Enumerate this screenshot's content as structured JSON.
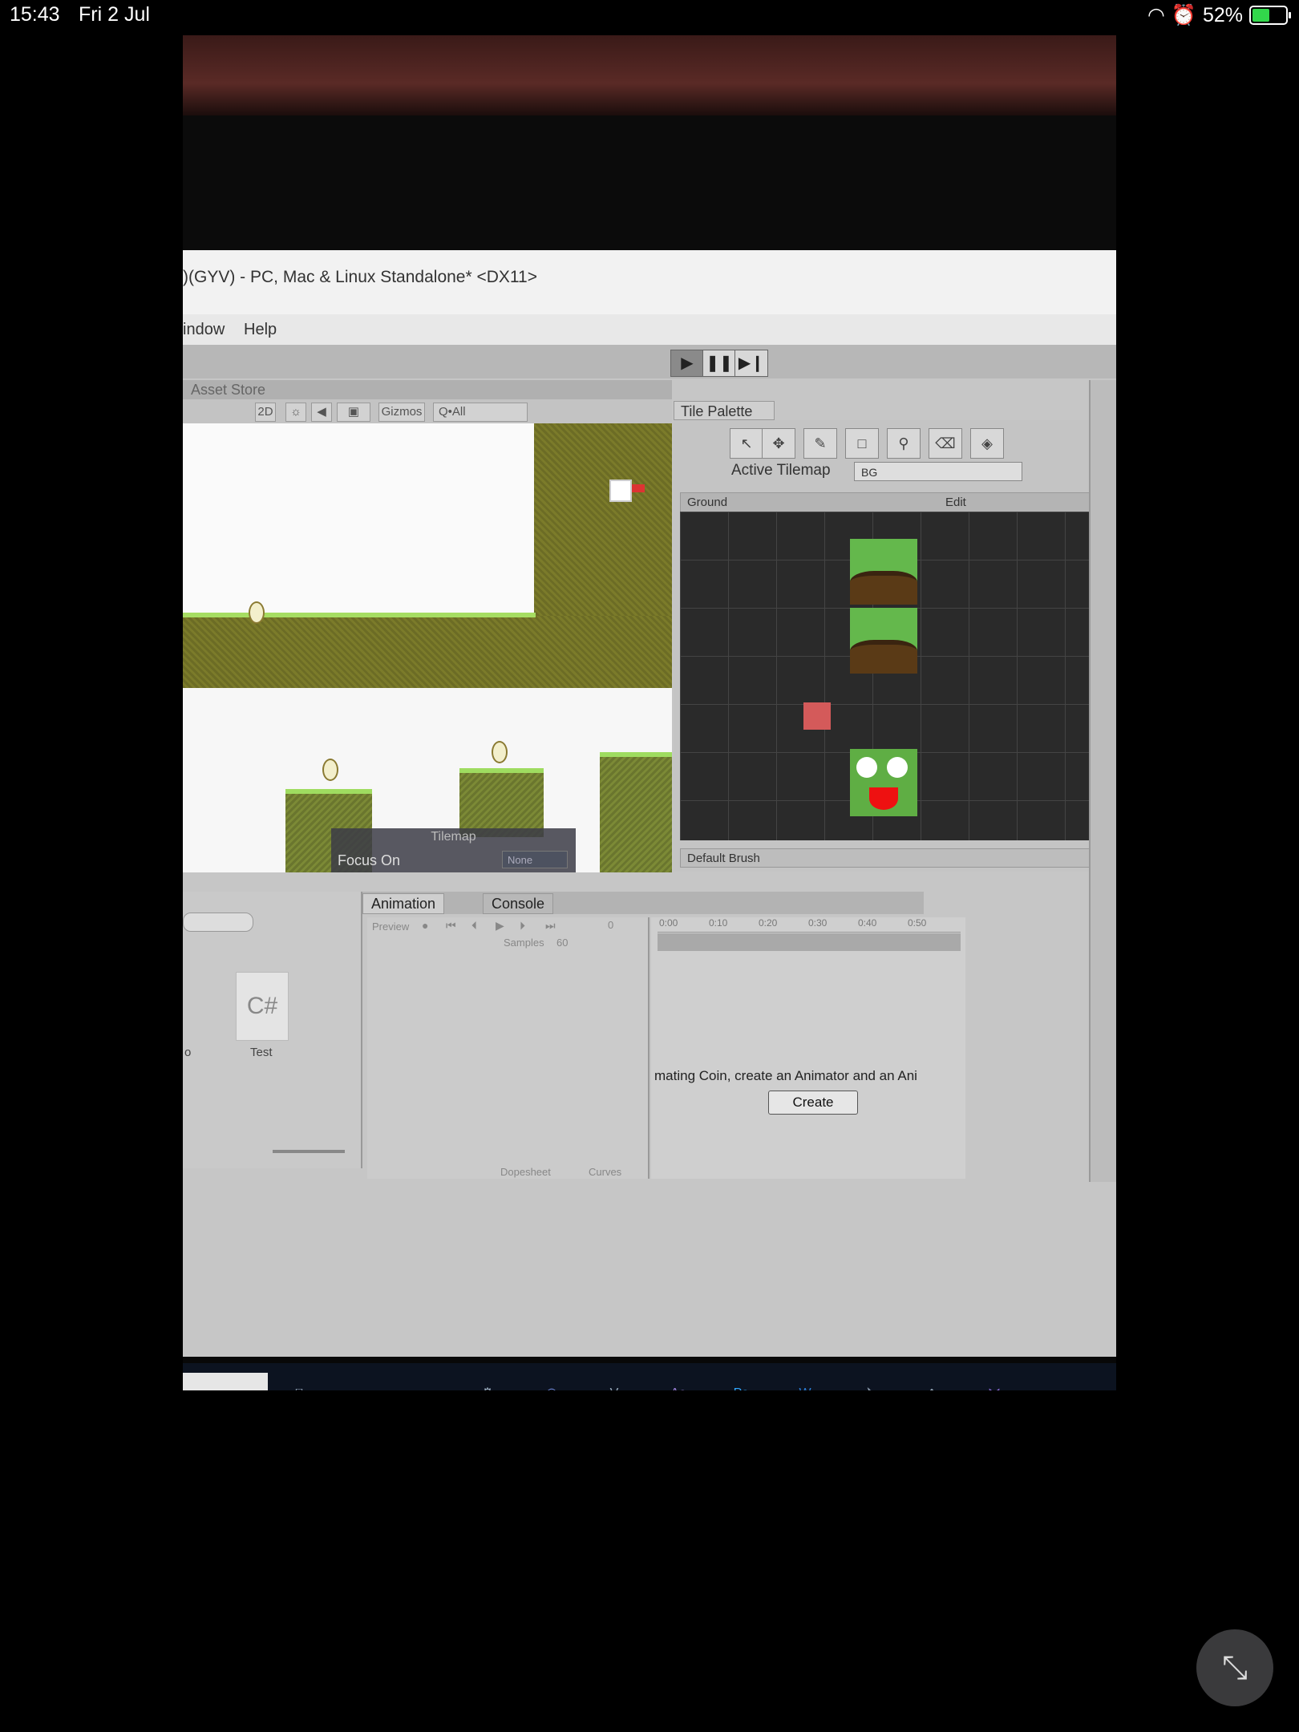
{
  "status": {
    "time": "15:43",
    "date": "Fri 2 Jul",
    "battery_percent": "52%",
    "battery_level": 0.52
  },
  "unity": {
    "title": ")(GYV) - PC, Mac & Linux Standalone* <DX11>",
    "menu": [
      "indow",
      "Help"
    ],
    "play_controls": [
      "play-icon",
      "pause-icon",
      "step-icon"
    ],
    "scene": {
      "asset_store_tab": "Asset Store",
      "mode_2d": "2D",
      "gizmos": "Gizmos",
      "search_placeholder": "Q•All",
      "tilemap_overlay": {
        "title": "Tilemap",
        "focus_label": "Focus On",
        "focus_value": "None"
      }
    },
    "tile_palette": {
      "tab": "Tile Palette",
      "tools": [
        "select-icon",
        "move-icon",
        "paint-brush-icon",
        "box-fill-icon",
        "picker-icon",
        "eraser-icon",
        "fill-icon"
      ],
      "active_tilemap_label": "Active Tilemap",
      "active_tilemap_value": "BG",
      "palette_name": "Ground",
      "edit_label": "Edit",
      "brush": "Default Brush"
    },
    "project": {
      "asset_icon": "C#",
      "asset_name": "Test",
      "cut_label": "o"
    },
    "animation": {
      "tabs": [
        "Animation",
        "Console"
      ],
      "preview_label": "Preview",
      "samples_label": "Samples",
      "samples_value": "60",
      "frame_value": "0",
      "ruler": [
        "0:00",
        "0:10",
        "0:20",
        "0:30",
        "0:40",
        "0:50"
      ],
      "message": "mating Coin, create an Animator and an Ani",
      "create_button": "Create",
      "bottom_tabs": [
        "Dopesheet",
        "Curves"
      ]
    },
    "taskbar_icons": [
      "task-view-icon",
      "firefox-icon",
      "file-explorer-icon",
      "steam-icon",
      "discord-icon",
      "vegas-icon",
      "after-effects-icon",
      "photoshop-icon",
      "word-icon",
      "steam-vr-icon",
      "unity-icon",
      "visual-studio-icon"
    ],
    "taskbar_labels": {
      "vegas": "V",
      "ae": "Ae",
      "ps": "Ps",
      "word": "W"
    }
  }
}
